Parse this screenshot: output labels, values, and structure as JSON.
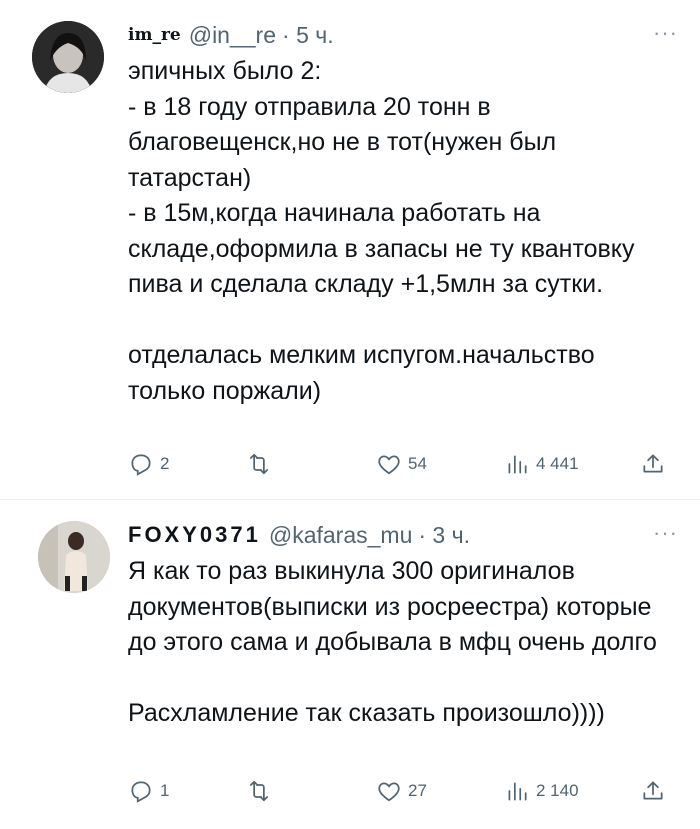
{
  "tweets": [
    {
      "name": "im_re",
      "handle": "@in__re",
      "time": "· 5 ч.",
      "more": "···",
      "text": "эпичных было 2:\n- в 18 году отправила 20 тонн в благовещенск,но не в тот(нужен был татарстан)\n- в 15м,когда начинала работать на складе,оформила в запасы не ту квантовку пива и сделала складу +1,5млн за сутки.\n\nотделалась мелким испугом.начальство только поржали)",
      "replies": "2",
      "retweets": "",
      "likes": "54",
      "views": "4 441"
    },
    {
      "name": "FOXY0371",
      "handle": "@kafaras_mu",
      "time": "· 3 ч.",
      "more": "···",
      "text": "Я как то раз выкинула 300 оригиналов документов(выписки из росреестра) которые до этого сама и добывала в мфц очень долго\n\nРасхламление так сказать произошло))))",
      "replies": "1",
      "retweets": "",
      "likes": "27",
      "views": "2 140"
    }
  ],
  "colors": {
    "text": "#0f1419",
    "secondary": "#536471",
    "divider": "#eff3f4"
  },
  "icons": [
    "avatar-photo",
    "reply-icon",
    "retweet-icon",
    "like-icon",
    "views-icon",
    "share-icon",
    "more-icon"
  ]
}
